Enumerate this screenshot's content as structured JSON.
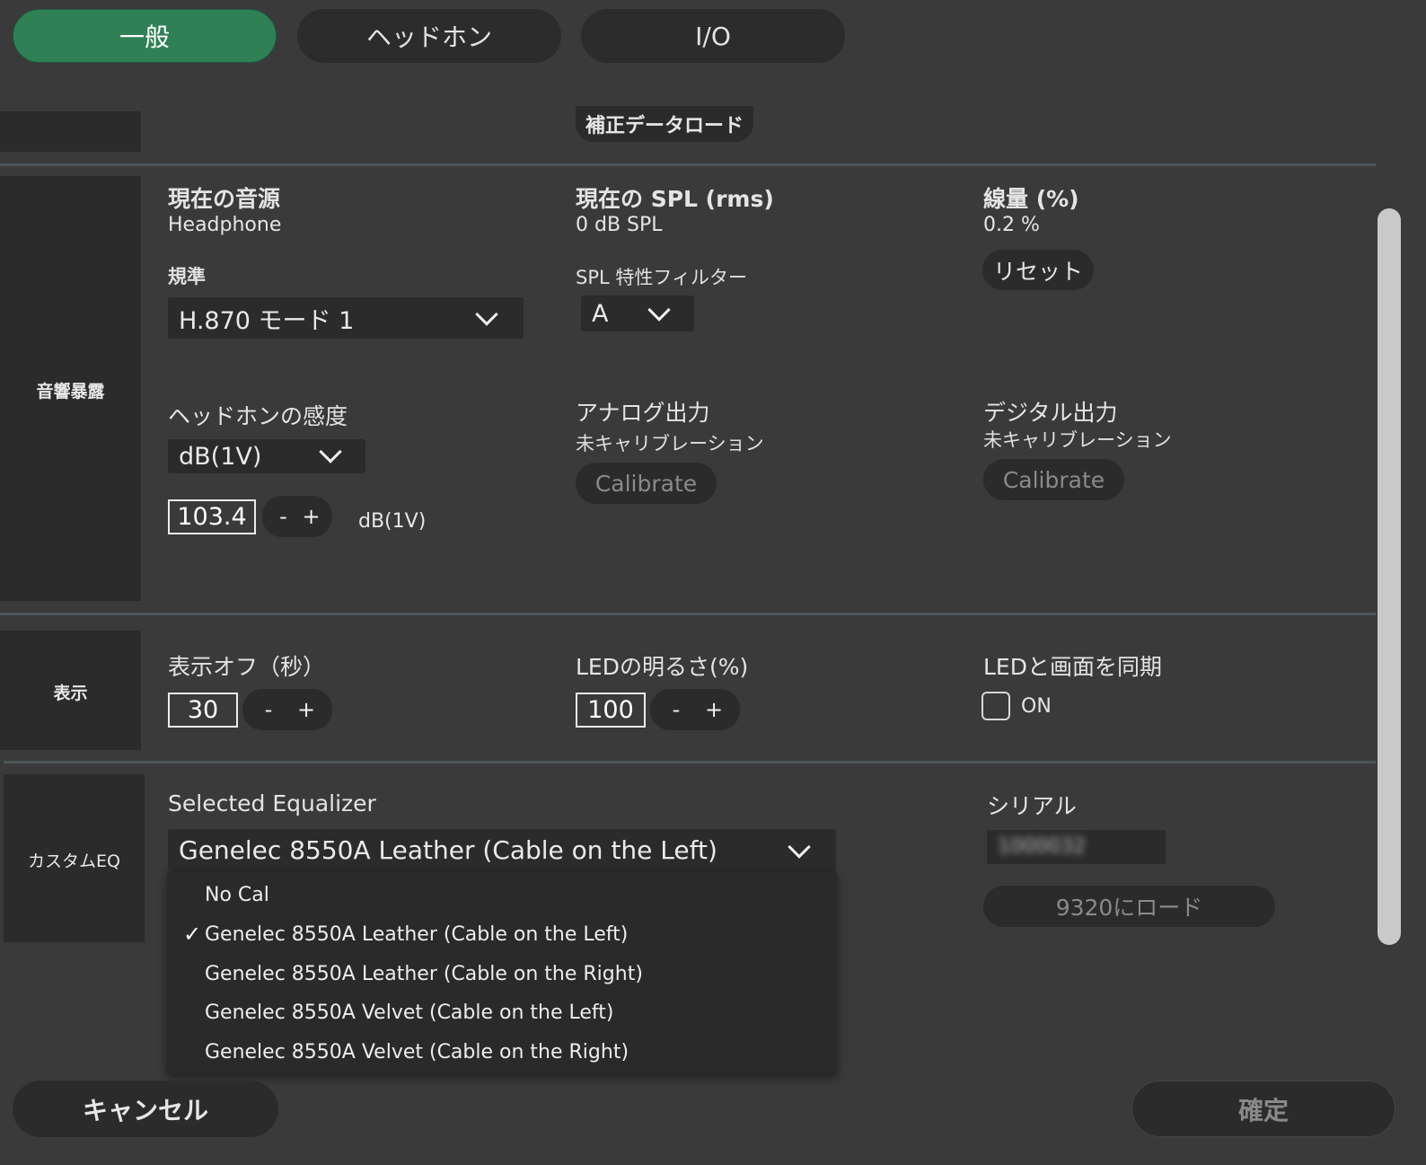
{
  "tabs": [
    {
      "label": "一般"
    },
    {
      "label": "ヘッドホン"
    },
    {
      "label": "I/O"
    }
  ],
  "top": {
    "load_calibration_label": "補正データロード"
  },
  "exposure": {
    "section_label": "音響暴露",
    "current_source_label": "現在の音源",
    "current_source_value": "Headphone",
    "current_spl_label": "現在の SPL (rms)",
    "current_spl_value": "0 dB SPL",
    "dose_label": "線量 (%)",
    "dose_value": "0.2 %",
    "reset_label": "リセット",
    "standard_label": "規準",
    "standard_value": "H.870 モード 1",
    "spl_filter_label": "SPL 特性フィルター",
    "spl_filter_value": "A",
    "sensitivity_label": "ヘッドホンの感度",
    "sensitivity_unit_select": "dB(1V)",
    "sensitivity_value": "103.4",
    "sensitivity_unit": "dB(1V)",
    "minus": "-",
    "plus": "+",
    "analog_out_label": "アナログ出力",
    "analog_out_status": "未キャリブレーション",
    "digital_out_label": "デジタル出力",
    "digital_out_status": "未キャリブレーション",
    "calibrate_label": "Calibrate"
  },
  "display": {
    "section_label": "表示",
    "off_label": "表示オフ（秒）",
    "off_value": "30",
    "led_brightness_label": "LEDの明るさ(%)",
    "led_brightness_value": "100",
    "led_sync_label": "LEDと画面を同期",
    "led_sync_on_label": "ON",
    "led_sync_checked": false,
    "minus": "-",
    "plus": "+"
  },
  "eq": {
    "section_label": "カスタムEQ",
    "selected_label": "Selected Equalizer",
    "selected_value": "Genelec 8550A Leather (Cable on the Left)",
    "options": [
      {
        "label": "No Cal",
        "checked": false
      },
      {
        "label": "Genelec 8550A Leather (Cable on the Left)",
        "checked": true
      },
      {
        "label": "Genelec 8550A Leather (Cable on the Right)",
        "checked": false
      },
      {
        "label": "Genelec 8550A Velvet (Cable on the Left)",
        "checked": false
      },
      {
        "label": "Genelec 8550A Velvet (Cable on the Right)",
        "checked": false
      }
    ],
    "check_glyph": "✓",
    "serial_label": "シリアル",
    "serial_value": "1000032",
    "load_to_device_label": "9320にロード"
  },
  "footer": {
    "cancel_label": "キャンセル",
    "confirm_label": "確定"
  },
  "colors": {
    "active_tab": "#2f8055",
    "background": "#3a3a3a",
    "panel": "#2b2b2b"
  }
}
